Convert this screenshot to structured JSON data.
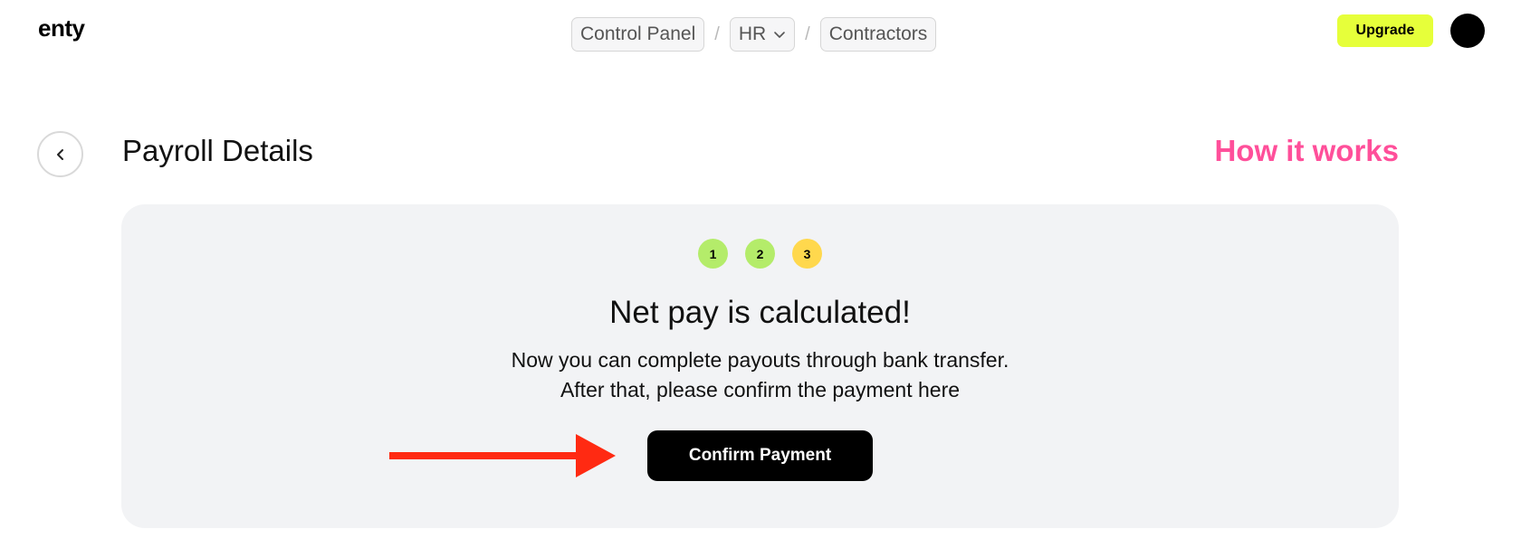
{
  "header": {
    "logo": "enty",
    "breadcrumb": [
      {
        "label": "Control Panel"
      },
      {
        "label": "HR",
        "has_dropdown": true
      },
      {
        "label": "Contractors"
      }
    ],
    "separator": "/",
    "upgrade_label": "Upgrade"
  },
  "title_row": {
    "title": "Payroll Details",
    "help_link": "How it works"
  },
  "card": {
    "steps": [
      {
        "number": "1",
        "state": "done"
      },
      {
        "number": "2",
        "state": "done"
      },
      {
        "number": "3",
        "state": "current"
      }
    ],
    "title": "Net pay is calculated!",
    "text_line1": "Now you can complete payouts through bank transfer.",
    "text_line2": "After that, please confirm the payment here",
    "confirm_label": "Confirm Payment"
  },
  "colors": {
    "accent_yellow": "#e6ff3a",
    "link_pink": "#ff4f9a",
    "step_done": "#b4ec6a",
    "step_current": "#ffd84d",
    "arrow_red": "#ff2a12"
  },
  "icons": {
    "back": "chevron-left-icon",
    "dropdown": "chevron-down-icon",
    "annotation": "red-arrow-icon"
  }
}
